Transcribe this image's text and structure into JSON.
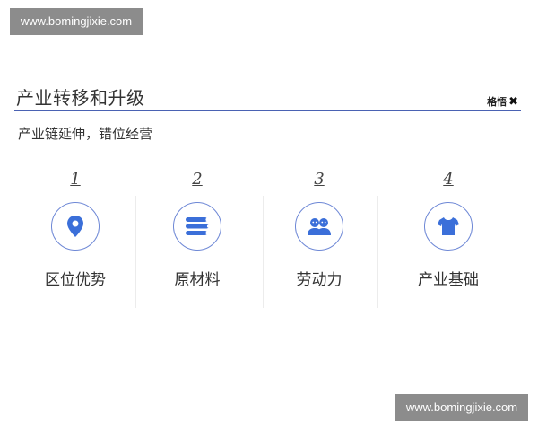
{
  "watermark": {
    "top": "www.bomingjixie.com",
    "bottom": "www.bomingjixie.com"
  },
  "header": {
    "title": "产业转移和升级",
    "brand": "格悟",
    "brand_mark": "✖"
  },
  "subtitle": "产业链延伸，错位经营",
  "items": [
    {
      "number": "1",
      "label": "区位优势",
      "icon": "location-pin-icon"
    },
    {
      "number": "2",
      "label": "原材料",
      "icon": "material-stack-icon"
    },
    {
      "number": "3",
      "label": "劳动力",
      "icon": "people-icon"
    },
    {
      "number": "4",
      "label": "产业基础",
      "icon": "tshirt-icon"
    }
  ],
  "colors": {
    "accent": "#3b6fd9",
    "title_line": "#4a62b3",
    "circle_border": "#6e88d6",
    "watermark_bg": "#8c8c8c"
  }
}
